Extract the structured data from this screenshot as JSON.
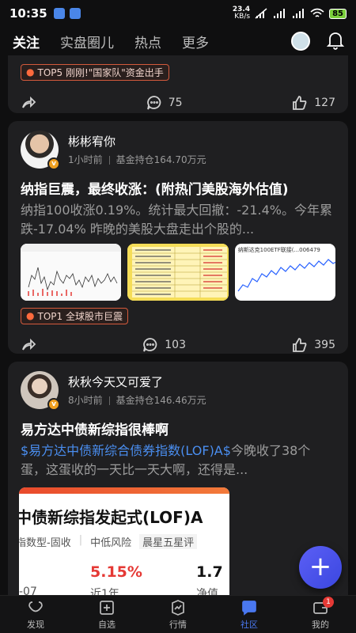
{
  "status_bar": {
    "time": "10:35",
    "net_speed_top": "23.4",
    "net_speed_unit": "KB/s",
    "battery": "85"
  },
  "top_nav": {
    "tabs": [
      "关注",
      "实盘圈儿",
      "热点",
      "更多"
    ]
  },
  "posts": [
    {
      "tag": "TOP5 刚刚!\"国家队\"资金出手",
      "comments": "75",
      "likes": "127"
    },
    {
      "user": "彬彬宥你",
      "time_ago": "1小时前",
      "holding": "基金持仓164.70万元",
      "title": "纳指巨震，最终收涨：(附热门美股海外估值)",
      "body": "纳指100收涨0.19%。统计最大回撤：-21.4%。今年累跌-17.04% 昨晚的美股大盘走出个股的...",
      "tag": "TOP1 全球股市巨震",
      "comments": "103",
      "likes": "395",
      "thumb3_title": "纳斯达克100ETF联接(...006479"
    },
    {
      "user": "秋秋今天又可爱了",
      "time_ago": "8小时前",
      "holding": "基金持仓146.46万元",
      "title": "易方达中债新综指很棒啊",
      "link": "$易方达中债新综合债券指数(LOF)A$",
      "body_after_link": "今晚收了38个蛋，这蛋收的一天比一天大啊，还得是...",
      "fund_card": {
        "name": "中债新综指发起式(LOF)A",
        "type": "指数型-固收",
        "risk": "中低风险",
        "rating": "晨星五星评",
        "return": "5.15%",
        "return_label": "近1年",
        "nav_value": "1.7",
        "nav_label": "净值",
        "date_frag": "-07"
      }
    }
  ],
  "bottom_nav": {
    "items": [
      "发现",
      "自选",
      "行情",
      "社区",
      "我的"
    ],
    "badge": "1"
  },
  "colors": {
    "accent": "#4a78f0",
    "tag_border": "#d45a3c",
    "return_red": "#e53935"
  }
}
